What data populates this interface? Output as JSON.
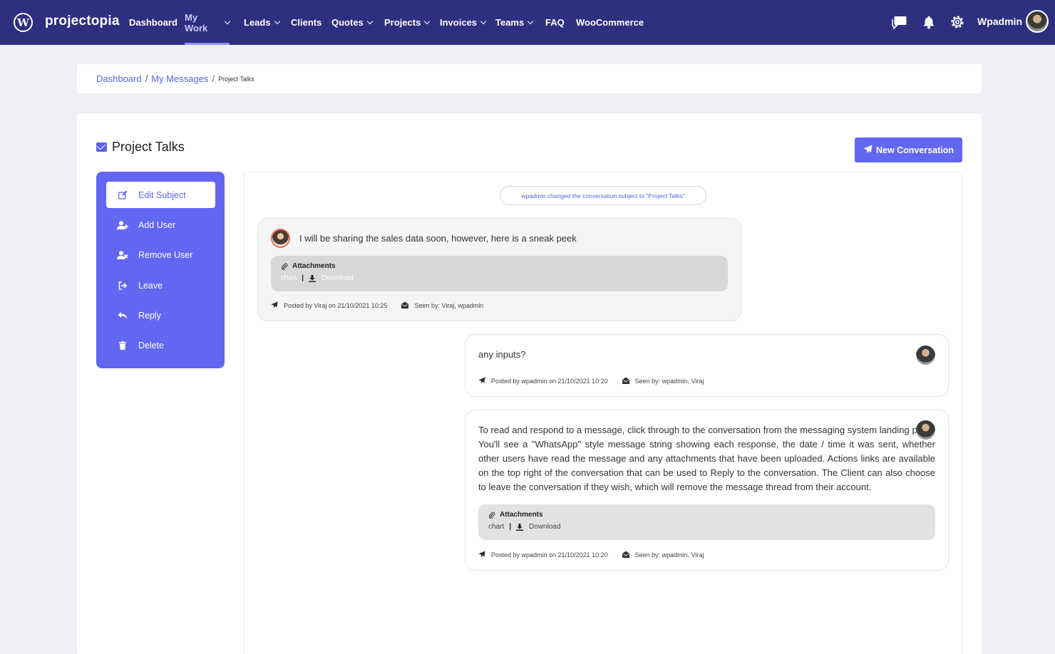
{
  "brand": "projectopia",
  "nav": {
    "items": [
      {
        "label": "Dashboard",
        "dropdown": false
      },
      {
        "label": "My Work",
        "dropdown": true,
        "active": true
      },
      {
        "label": "Leads",
        "dropdown": true
      },
      {
        "label": "Clients",
        "dropdown": false
      },
      {
        "label": "Quotes",
        "dropdown": true
      },
      {
        "label": "Projects",
        "dropdown": true
      },
      {
        "label": "Invoices",
        "dropdown": true
      },
      {
        "label": "Teams",
        "dropdown": true
      },
      {
        "label": "FAQ",
        "dropdown": false
      },
      {
        "label": "WooCommerce",
        "dropdown": false
      }
    ],
    "icons": [
      "chat-icon",
      "bell-icon",
      "gear-icon"
    ],
    "user_name": "Wpadmin"
  },
  "breadcrumb": {
    "items": [
      "Dashboard",
      "My Messages"
    ],
    "current": "Project Talks"
  },
  "page": {
    "title": "Project Talks",
    "new_conversation": "New Conversation"
  },
  "actions": [
    {
      "label": "Edit Subject",
      "icon": "edit-icon",
      "selected": true
    },
    {
      "label": "Add User",
      "icon": "user-plus-icon"
    },
    {
      "label": "Remove User",
      "icon": "user-remove-icon"
    },
    {
      "label": "Leave",
      "icon": "sign-out-icon"
    },
    {
      "label": "Reply",
      "icon": "reply-icon"
    },
    {
      "label": "Delete",
      "icon": "trash-icon"
    }
  ],
  "conversation": {
    "system_note": "wpadmin changed the conversation subject to \"Project Talks\"",
    "messages": [
      {
        "side": "left",
        "text": "I will be sharing the sales data soon, however, here is a sneak peek",
        "attachments_label": "Attachments",
        "attachment_name": "chart",
        "download_label": "Download",
        "posted": "Posted by Viraj on 21/10/2021 10:25",
        "seen": "Seen by: Viraj, wpadmin"
      },
      {
        "side": "right",
        "text": "any inputs?",
        "posted": "Posted by wpadmin on 21/10/2021 10:20",
        "seen": "Seen by: wpadmin, Viraj"
      },
      {
        "side": "right",
        "text": "To read and respond to a message, click through to the conversation from the messaging system landing page. You'll see a \"WhatsApp\" style message string showing each response, the date / time it was sent, whether other users have read the message and any attachments that have been uploaded. Actions links are available on the top right of the conversation that can be used to Reply to the conversation. The Client can also choose to leave the conversation if they wish, which will remove the message thread from their account.",
        "attachments_label": "Attachments",
        "attachment_name": "chart",
        "download_label": "Download",
        "posted": "Posted by wpadmin on 21/10/2021 10:20",
        "seen": "Seen by: wpadmin, Viraj"
      }
    ]
  },
  "colors": {
    "nav_bg": "#2d2f7f",
    "accent": "#6366f1",
    "page_bg": "#eef0f4"
  }
}
